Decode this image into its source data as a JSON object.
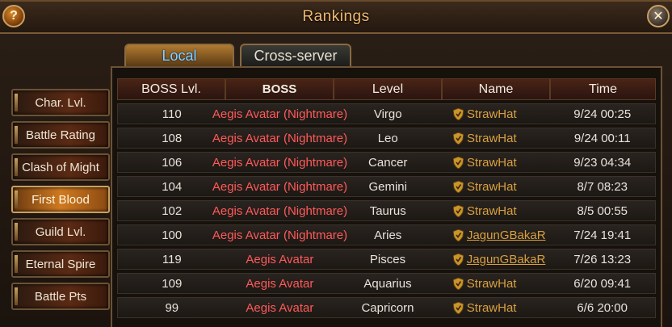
{
  "window": {
    "title": "Rankings",
    "help_label": "?",
    "close_label": "✕"
  },
  "tabs": [
    {
      "label": "Local",
      "active": true
    },
    {
      "label": "Cross-server",
      "active": false
    }
  ],
  "sidebar": {
    "items": [
      {
        "label": "Char. Lvl."
      },
      {
        "label": "Battle Rating"
      },
      {
        "label": "Clash of Might"
      },
      {
        "label": "First Blood",
        "active": true
      },
      {
        "label": "Guild Lvl."
      },
      {
        "label": "Eternal Spire"
      },
      {
        "label": "Battle Pts"
      }
    ]
  },
  "table": {
    "headers": [
      "BOSS Lvl.",
      "BOSS",
      "Level",
      "Name",
      "Time"
    ],
    "rows": [
      {
        "boss_lvl": "110",
        "boss": "Aegis Avatar (Nightmare)",
        "level": "Virgo",
        "name": "StrawHat",
        "time": "9/24 00:25"
      },
      {
        "boss_lvl": "108",
        "boss": "Aegis Avatar (Nightmare)",
        "level": "Leo",
        "name": "StrawHat",
        "time": "9/24 00:11"
      },
      {
        "boss_lvl": "106",
        "boss": "Aegis Avatar (Nightmare)",
        "level": "Cancer",
        "name": "StrawHat",
        "time": "9/23 04:34"
      },
      {
        "boss_lvl": "104",
        "boss": "Aegis Avatar (Nightmare)",
        "level": "Gemini",
        "name": "StrawHat",
        "time": "8/7 08:23"
      },
      {
        "boss_lvl": "102",
        "boss": "Aegis Avatar (Nightmare)",
        "level": "Taurus",
        "name": "StrawHat",
        "time": "8/5 00:55"
      },
      {
        "boss_lvl": "100",
        "boss": "Aegis Avatar (Nightmare)",
        "level": "Aries",
        "name": "JagunGBakaR",
        "time": "7/24 19:41"
      },
      {
        "boss_lvl": "119",
        "boss": "Aegis Avatar",
        "level": "Pisces",
        "name": "JagunGBakaR",
        "time": "7/26 13:23"
      },
      {
        "boss_lvl": "109",
        "boss": "Aegis Avatar",
        "level": "Aquarius",
        "name": "StrawHat",
        "time": "6/20 09:41"
      },
      {
        "boss_lvl": "99",
        "boss": "Aegis Avatar",
        "level": "Capricorn",
        "name": "StrawHat",
        "time": "6/6 20:00"
      }
    ]
  },
  "colors": {
    "title": "#f0b870",
    "boss_name": "#ff5a5a",
    "player_name": "#d8a040",
    "active_tab_text": "#7fd6ff"
  },
  "icons": {
    "guild_badge": "shield-icon"
  }
}
